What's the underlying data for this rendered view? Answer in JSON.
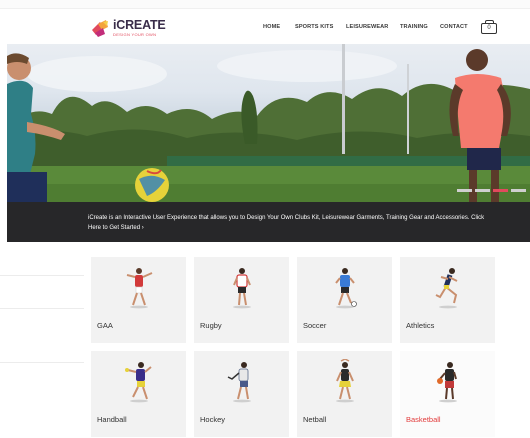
{
  "brand": {
    "name": "iCREATE",
    "tagline": "DESIGN YOUR OWN",
    "colors": {
      "accent": "#e14a5d",
      "dark": "#3a2d4a",
      "caption_bg": "#272729",
      "active_label": "#e23c3c"
    }
  },
  "nav": {
    "items": [
      {
        "label": "HOME"
      },
      {
        "label": "SPORTS KITS"
      },
      {
        "label": "LEISUREWEAR"
      },
      {
        "label": "TRAINING"
      },
      {
        "label": "CONTACT"
      }
    ],
    "cart_icon": "cart-icon",
    "cart_count": "0"
  },
  "hero": {
    "caption": "iCreate is an Interactive User Experience that allows you to Design Your Own Clubs Kit, Leisurewear Garments, Training Gear and Accessories. Click Here to Get Started ›",
    "slides": 4,
    "active_slide": 3
  },
  "categories": [
    {
      "label": "GAA",
      "icon": "gaa-player-icon"
    },
    {
      "label": "Rugby",
      "icon": "rugby-player-icon"
    },
    {
      "label": "Soccer",
      "icon": "soccer-player-icon"
    },
    {
      "label": "Athletics",
      "icon": "athletics-runner-icon"
    },
    {
      "label": "Handball",
      "icon": "handball-player-icon"
    },
    {
      "label": "Hockey",
      "icon": "hockey-player-icon"
    },
    {
      "label": "Netball",
      "icon": "netball-player-icon"
    },
    {
      "label": "Basketball",
      "icon": "basketball-player-icon",
      "active": true
    }
  ]
}
